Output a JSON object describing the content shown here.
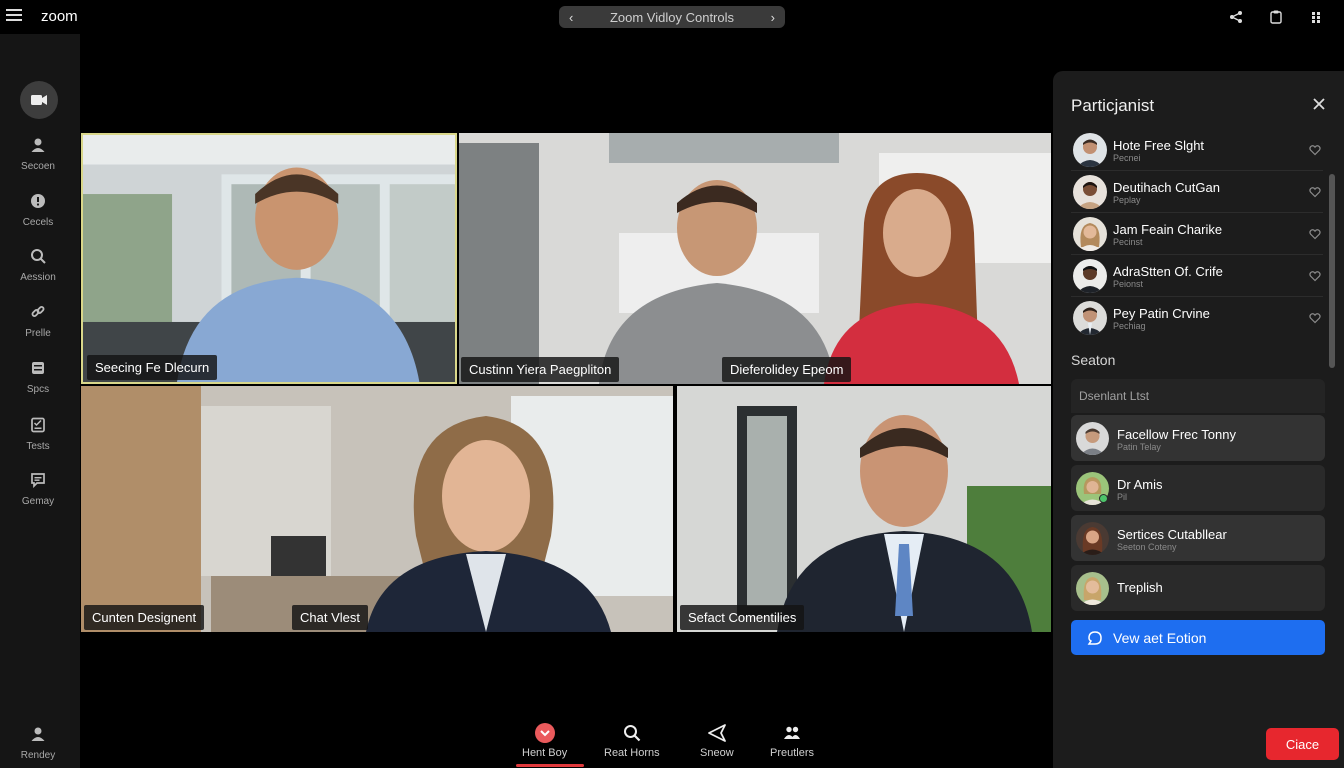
{
  "app": {
    "title": "zoom"
  },
  "title_bar": {
    "label": "Zoom Vidloy Controls"
  },
  "top_icons": [
    "share-icon",
    "clipboard-icon",
    "apps-grid-icon"
  ],
  "sidebar": {
    "items": [
      {
        "label": "Secoen",
        "icon": "person-icon"
      },
      {
        "label": "Cecels",
        "icon": "circle-info-icon"
      },
      {
        "label": "Aession",
        "icon": "search-icon"
      },
      {
        "label": "Prelle",
        "icon": "link-icon"
      },
      {
        "label": "Spcs",
        "icon": "layers-icon"
      },
      {
        "label": "Tests",
        "icon": "checklist-icon"
      },
      {
        "label": "Gemay",
        "icon": "chat-icon"
      }
    ],
    "bottom_item": {
      "label": "Rendey",
      "icon": "person-settings-icon"
    }
  },
  "videos": [
    {
      "name": "Seecing Fe Dlecurn"
    },
    {
      "name": "Custinn Yiera Paegpliton"
    },
    {
      "name": "Dieferolidey Epeom"
    },
    {
      "name": "Cunten Designent"
    },
    {
      "name": "Chat Vlest"
    },
    {
      "name": "Sefact Comentilies"
    }
  ],
  "toolbar": {
    "items": [
      {
        "label": "Hent Boy",
        "icon": "heart-icon",
        "active": true
      },
      {
        "label": "Reat Horns",
        "icon": "search-icon"
      },
      {
        "label": "Sneow",
        "icon": "send-icon"
      },
      {
        "label": "Preutlers",
        "icon": "people-icon"
      }
    ]
  },
  "panel": {
    "title": "Particjanist",
    "participants": [
      {
        "name": "Hote Free Slght",
        "sub": "Pecnei"
      },
      {
        "name": "Deutihach CutGan",
        "sub": "Peplay"
      },
      {
        "name": "Jam Feain Charike",
        "sub": "Pecinst"
      },
      {
        "name": "AdraStten Of. Crife",
        "sub": "Peionst"
      },
      {
        "name": "Pey Patin Crvine",
        "sub": "Pechiag"
      }
    ],
    "section_label": "Seaton",
    "search_placeholder": "Dsenlant Ltst",
    "cards": [
      {
        "name": "Facellow Frec Tonny",
        "sub": "Patin Telay"
      },
      {
        "name": "Dr Amis",
        "sub": "Pil"
      },
      {
        "name": "Sertices Cutabllear",
        "sub": "Seeton Coteny"
      },
      {
        "name": "Treplish",
        "sub": ""
      }
    ],
    "view_button": "Vew aet Eotion",
    "close_button": "Ciace"
  },
  "colors": {
    "accent": "#1e6ef0",
    "danger": "#e7272e",
    "panel_bg": "#1c1c1c",
    "active_tab": "#e0393c"
  }
}
